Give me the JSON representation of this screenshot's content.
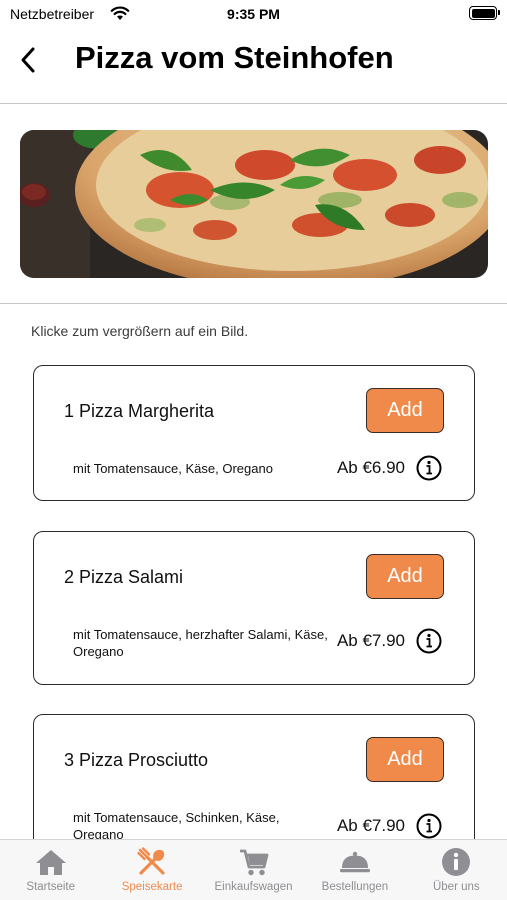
{
  "status_bar": {
    "carrier": "Netzbetreiber",
    "time": "9:35 PM"
  },
  "nav": {
    "title": "Pizza vom Steinhofen"
  },
  "hint": "Klicke zum vergrößern auf ein Bild.",
  "accent_color": "#f08a4b",
  "items": [
    {
      "name": "1 Pizza Margherita",
      "add_label": "Add",
      "description": "mit Tomatensauce, Käse, Oregano",
      "price": "Ab €6.90"
    },
    {
      "name": "2 Pizza Salami",
      "add_label": "Add",
      "description": "mit Tomatensauce, herzhafter Salami, Käse, Oregano",
      "price": "Ab €7.90"
    },
    {
      "name": "3 Pizza Prosciutto",
      "add_label": "Add",
      "description": "mit Tomatensauce, Schinken, Käse, Oregano",
      "price": "Ab €7.90"
    }
  ],
  "tabs": [
    {
      "label": "Startseite",
      "icon": "home-icon",
      "active": false
    },
    {
      "label": "Speisekarte",
      "icon": "fork-knife-icon",
      "active": true
    },
    {
      "label": "Einkaufswagen",
      "icon": "cart-icon",
      "active": false
    },
    {
      "label": "Bestellungen",
      "icon": "cloche-icon",
      "active": false
    },
    {
      "label": "Über uns",
      "icon": "info-icon",
      "active": false
    }
  ]
}
